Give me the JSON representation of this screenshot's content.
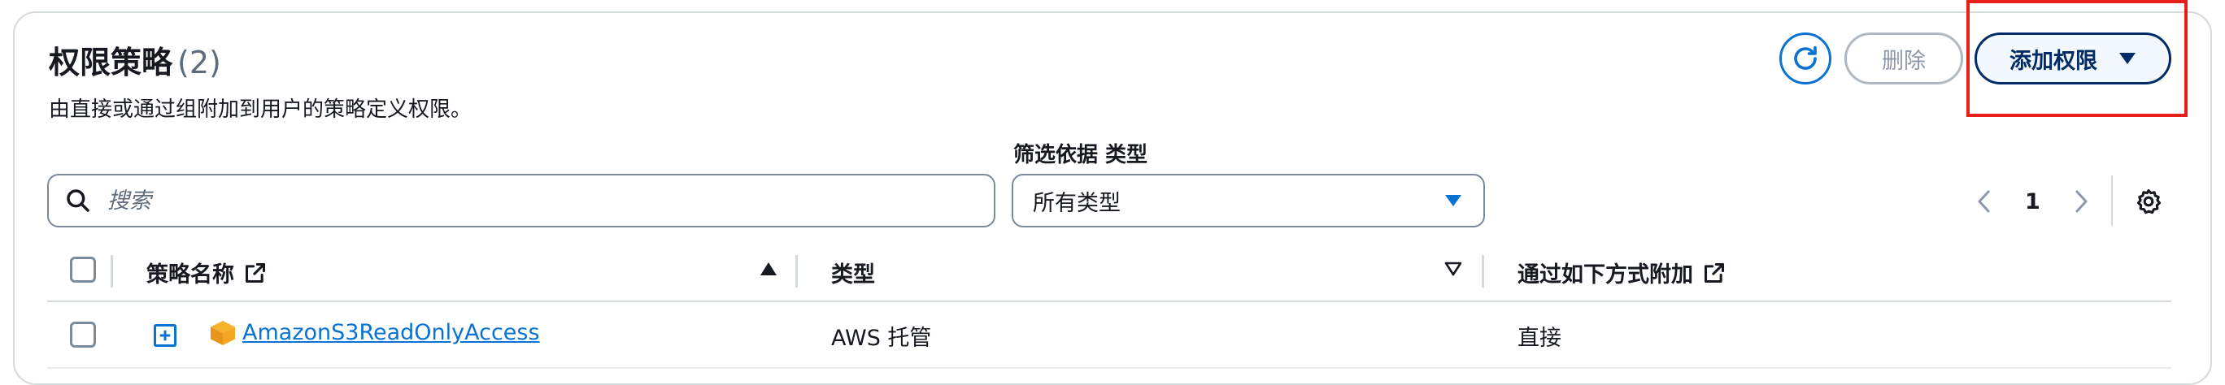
{
  "header": {
    "title": "权限策略",
    "count": "(2)",
    "description": "由直接或通过组附加到用户的策略定义权限。"
  },
  "actions": {
    "refresh_icon": "refresh-icon",
    "delete_label": "删除",
    "add_label": "添加权限"
  },
  "filter": {
    "search_placeholder": "搜索",
    "type_label": "筛选依据 类型",
    "type_selected": "所有类型"
  },
  "pagination": {
    "current_page": "1"
  },
  "table": {
    "columns": [
      {
        "label": "策略名称"
      },
      {
        "label": "类型"
      },
      {
        "label": "通过如下方式附加"
      }
    ],
    "rows": [
      {
        "name": "AmazonS3ReadOnlyAccess",
        "type": "AWS 托管",
        "attached_via": "直接"
      }
    ]
  },
  "colors": {
    "primary": "#0972d3",
    "primary_dark": "#002b66",
    "border": "#7d8998",
    "highlight": "#e8201a"
  }
}
